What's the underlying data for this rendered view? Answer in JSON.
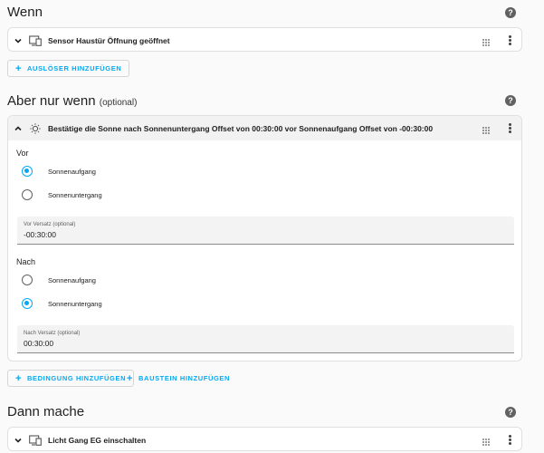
{
  "wenn": {
    "title": "Wenn",
    "trigger_label": "Sensor Haustür Öffnung geöffnet",
    "add_trigger": "AUSLÖSER HINZUFÜGEN"
  },
  "aber": {
    "title": "Aber nur wenn",
    "optional": "(optional)",
    "condition_label": "Bestätige die Sonne nach Sonnenuntergang Offset von 00:30:00 vor Sonnenaufgang Offset von -00:30:00",
    "before": {
      "label": "Vor",
      "options": [
        {
          "label": "Sonnenaufgang",
          "selected": true
        },
        {
          "label": "Sonnenuntergang",
          "selected": false
        }
      ],
      "offset_label": "Vor Versatz (optional)",
      "offset_value": "-00:30:00"
    },
    "after": {
      "label": "Nach",
      "options": [
        {
          "label": "Sonnenaufgang",
          "selected": false
        },
        {
          "label": "Sonnenuntergang",
          "selected": true
        }
      ],
      "offset_label": "Nach Versatz (optional)",
      "offset_value": "00:30:00"
    },
    "add_condition": "BEDINGUNG HINZUFÜGEN",
    "add_block": "BAUSTEIN HINZUFÜGEN"
  },
  "dann": {
    "title": "Dann mache",
    "action_label": "Licht Gang EG einschalten"
  },
  "help_glyph": "?",
  "colors": {
    "accent": "#03a9f4",
    "header_bg": "#f2f2f2"
  }
}
